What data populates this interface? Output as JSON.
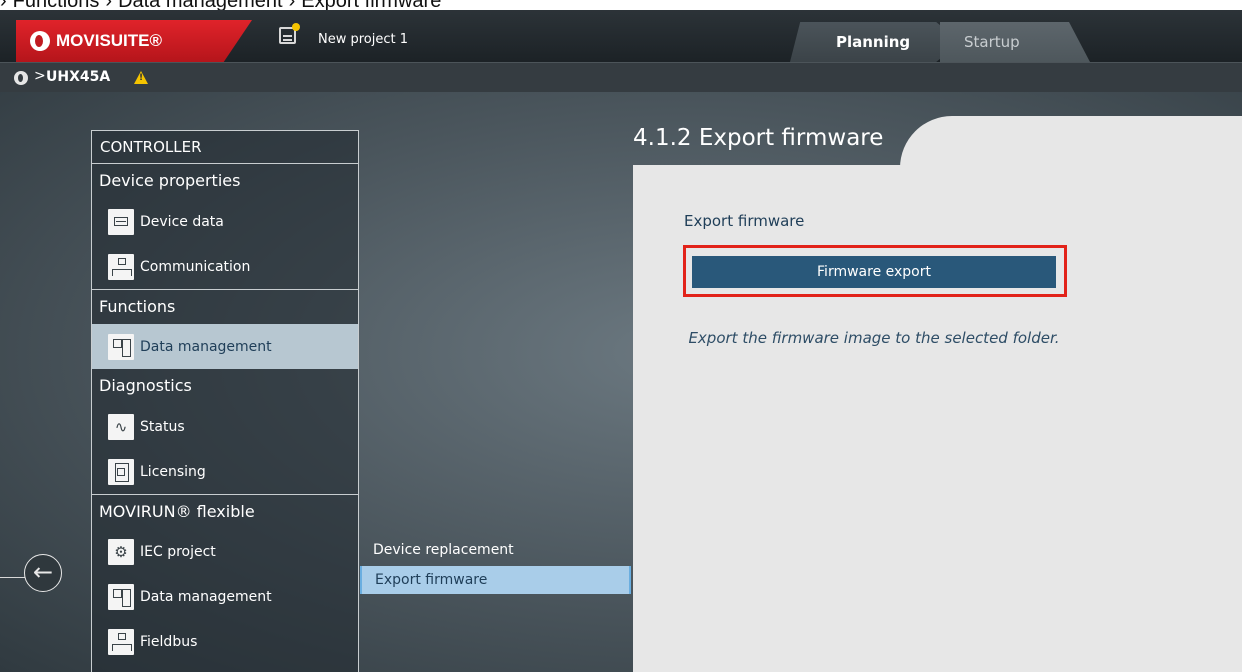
{
  "doc_breadcrumb": {
    "items": [
      "›",
      "Functions",
      "›",
      "Data management",
      "›",
      "Export firmware"
    ]
  },
  "titlebar": {
    "logo": "MOVISUITE®",
    "project_name": "New project 1",
    "tabs": [
      "Planning",
      "Startup"
    ]
  },
  "devicebar": {
    "chevron": ">",
    "device": "UHX45A"
  },
  "menu": {
    "header": "CONTROLLER",
    "sections": [
      {
        "title": "Device properties",
        "items": [
          "Device data",
          "Communication"
        ]
      },
      {
        "title": "Functions",
        "items": [
          "Data management"
        ]
      },
      {
        "title": "Diagnostics",
        "items": [
          "Status",
          "Licensing"
        ]
      },
      {
        "title": "MOVIRUN® flexible",
        "items": [
          "IEC project",
          "Data management",
          "Fieldbus"
        ]
      }
    ]
  },
  "submenu": {
    "items": [
      "Device replacement",
      "Export firmware"
    ]
  },
  "panel": {
    "title": "4.1.2 Export firmware",
    "heading": "Export firmware",
    "button": "Firmware export",
    "description": "Export the firmware image to the selected folder."
  },
  "colors": {
    "accent_red": "#e2231a",
    "button_blue": "#29587a",
    "active_item": "#b7c7d1",
    "selected_sub": "#a9cde9"
  }
}
